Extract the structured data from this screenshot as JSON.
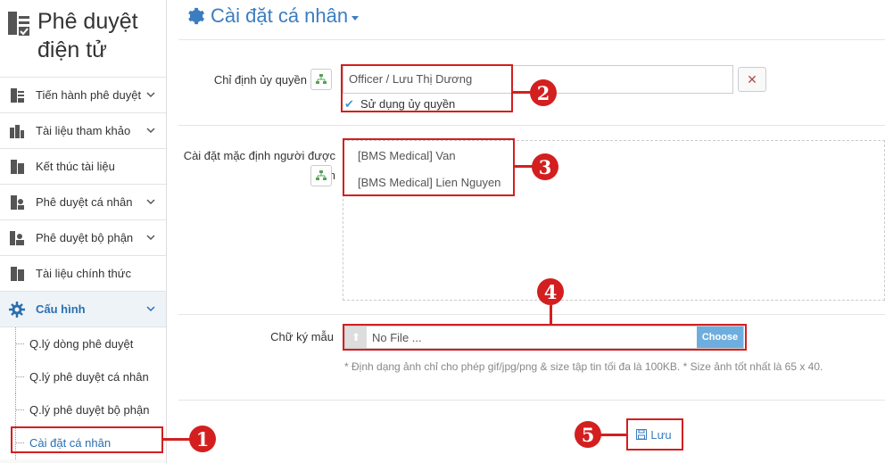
{
  "brand": {
    "title_line1": "Phê duyệt",
    "title_line2": "điện tử"
  },
  "sidebar": {
    "items": [
      {
        "label": "Tiến hành phê duyệt",
        "icon": "document-check-icon",
        "has_chevron": true
      },
      {
        "label": "Tài liệu tham khảo",
        "icon": "building-icon",
        "has_chevron": true
      },
      {
        "label": "Kết thúc tài liệu",
        "icon": "document-done-icon",
        "has_chevron": false
      },
      {
        "label": "Phê duyệt cá nhân",
        "icon": "document-person-icon",
        "has_chevron": true
      },
      {
        "label": "Phê duyệt bộ phận",
        "icon": "group-icon",
        "has_chevron": true
      },
      {
        "label": "Tài liệu chính thức",
        "icon": "document-official-icon",
        "has_chevron": false
      },
      {
        "label": "Cấu hình",
        "icon": "gear-icon",
        "has_chevron": true,
        "active": true
      }
    ],
    "sub_items": [
      {
        "label": "Q.lý dòng phê duyệt"
      },
      {
        "label": "Q.lý phê duyệt cá nhân"
      },
      {
        "label": "Q.lý phê duyệt bộ phận"
      },
      {
        "label": "Cài đặt cá nhân",
        "current": true
      }
    ]
  },
  "page": {
    "title": "Cài đặt cá nhân"
  },
  "form": {
    "delegate_label": "Chỉ định ủy quyền",
    "delegate_value": "Officer / Lưu Thị Dương",
    "use_delegate_label": "Sử dụng ủy quyền",
    "use_delegate_checked": true,
    "viewers_label_line1": "Cài đặt mặc định người được",
    "viewers_label_line2": "xem",
    "viewers": [
      "[BMS Medical] Van",
      "[BMS Medical] Lien Nguyen"
    ],
    "signature_label": "Chữ ký mẫu",
    "file_placeholder": "No File ...",
    "choose_label": "Choose",
    "hint": "* Định dạng ảnh chỉ cho phép gif/jpg/png & size tập tin tối đa là 100KB. * Size ảnh tốt nhất là 65 x 40.",
    "save_label": "Lưu"
  },
  "annotations": [
    "1",
    "2",
    "3",
    "4",
    "5"
  ],
  "colors": {
    "accent": "#3b7dc0",
    "annotation": "#d31f1f",
    "choose": "#6eaede"
  }
}
